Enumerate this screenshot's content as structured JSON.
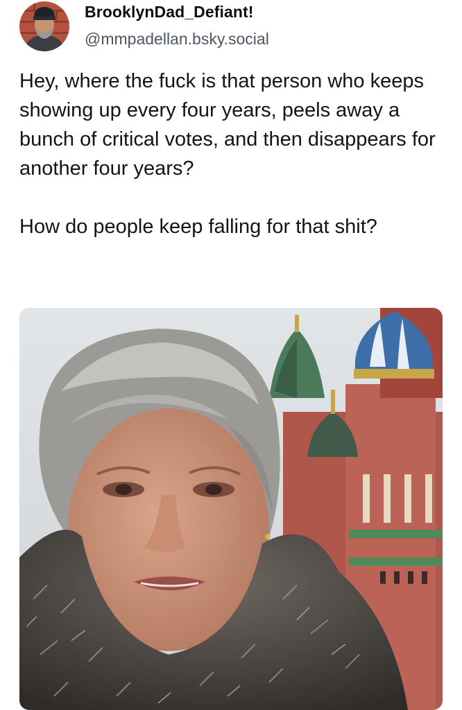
{
  "post": {
    "author": {
      "display_name": "BrooklynDad_Defiant!",
      "handle": "@mmpadellan.bsky.social"
    },
    "text": {
      "paragraph_1": "Hey, where the fuck is that person who keeps showing up every four years, peels away a bunch of critical votes, and then disappears for another four years?",
      "paragraph_2": "How do people keep falling for that shit?"
    },
    "media": {
      "type": "photo"
    }
  },
  "colors": {
    "text": "#111418",
    "handle": "#4b5563",
    "background": "#ffffff"
  }
}
